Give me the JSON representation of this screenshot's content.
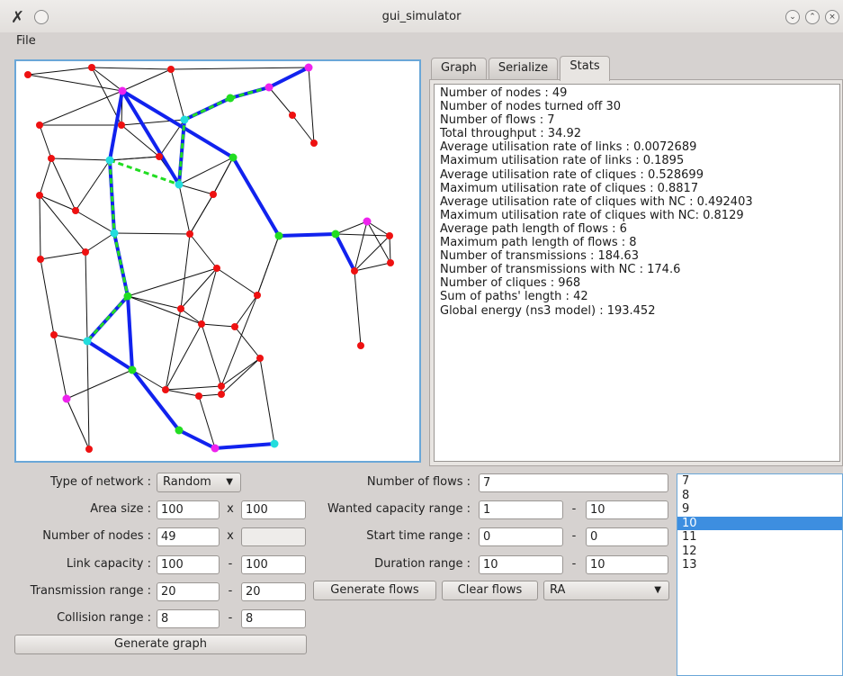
{
  "window": {
    "title": "gui_simulator"
  },
  "menu": {
    "file": "File"
  },
  "tabs": [
    {
      "label": "Graph"
    },
    {
      "label": "Serialize"
    },
    {
      "label": "Stats"
    }
  ],
  "active_tab": "Stats",
  "stats": [
    "Number of nodes : 49",
    "Number of nodes turned off 30",
    "Number of flows : 7",
    "Total throughput : 34.92",
    "Average utilisation rate of links : 0.0072689",
    "Maximum utilisation rate of links : 0.1895",
    "Average utilisation rate of cliques : 0.528699",
    "Maximum utilisation rate of cliques : 0.8817",
    "Average utilisation rate of cliques with NC : 0.492403",
    "Maximum utilisation rate of cliques with NC: 0.8129",
    "Average path length of flows : 6",
    "Maximum path length of flows : 8",
    "Number of transmissions : 184.63",
    "Number of transmissions with NC : 174.6",
    "Number of cliques : 968",
    "Sum of paths' length : 42",
    "Global energy (ns3 model) : 193.452"
  ],
  "network": {
    "type_label": "Type of network :",
    "type_value": "Random",
    "area_label": "Area size :",
    "area_x": "100",
    "area_sep": "x",
    "area_y": "100",
    "nodes_label": "Number of nodes :",
    "nodes_value": "49",
    "nodes_sep": "x",
    "nodes_extra": "",
    "capacity_label": "Link capacity :",
    "capacity_min": "100",
    "capacity_sep": "-",
    "capacity_max": "100",
    "tx_label": "Transmission range :",
    "tx_min": "20",
    "tx_sep": "-",
    "tx_max": "20",
    "collision_label": "Collision range :",
    "collision_min": "8",
    "collision_sep": "-",
    "collision_max": "8",
    "generate_graph": "Generate graph"
  },
  "flows": {
    "count_label": "Number of flows :",
    "count_value": "7",
    "capacity_label": "Wanted capacity range :",
    "capacity_min": "1",
    "capacity_sep": "-",
    "capacity_max": "10",
    "start_label": "Start time range :",
    "start_min": "0",
    "start_sep": "-",
    "start_max": "0",
    "duration_label": "Duration range :",
    "duration_min": "10",
    "duration_sep": "-",
    "duration_max": "10",
    "generate_flows": "Generate flows",
    "clear_flows": "Clear flows",
    "algorithm": "RA"
  },
  "flow_list": {
    "items": [
      "7",
      "8",
      "9",
      "10",
      "11",
      "12",
      "13"
    ],
    "selected": "10"
  },
  "graph_colors": {
    "node": "#ee1111",
    "flow_node_green": "#22dd22",
    "flow_node_cyan": "#22dddd",
    "flow_node_magenta": "#ee22ee",
    "flow_edge": "#1122ee"
  }
}
